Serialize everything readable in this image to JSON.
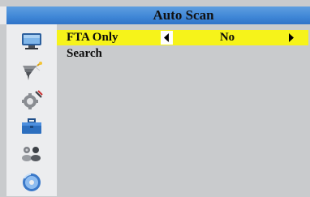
{
  "window": {
    "title": "Auto Scan"
  },
  "sidebar": {
    "items": [
      {
        "icon": "tv-monitor-icon"
      },
      {
        "icon": "satellite-dish-icon"
      },
      {
        "icon": "gear-settings-icon"
      },
      {
        "icon": "toolbox-icon"
      },
      {
        "icon": "game-controller-icon"
      },
      {
        "icon": "disc-media-icon"
      }
    ]
  },
  "menu": {
    "items": [
      {
        "label": "FTA Only",
        "value": "No",
        "selected": true
      },
      {
        "label": "Search"
      }
    ]
  },
  "colors": {
    "title_bar": "#3f86d6",
    "selection": "#f6f31a",
    "background": "#c9cbcd",
    "sidebar": "#ecedef"
  }
}
